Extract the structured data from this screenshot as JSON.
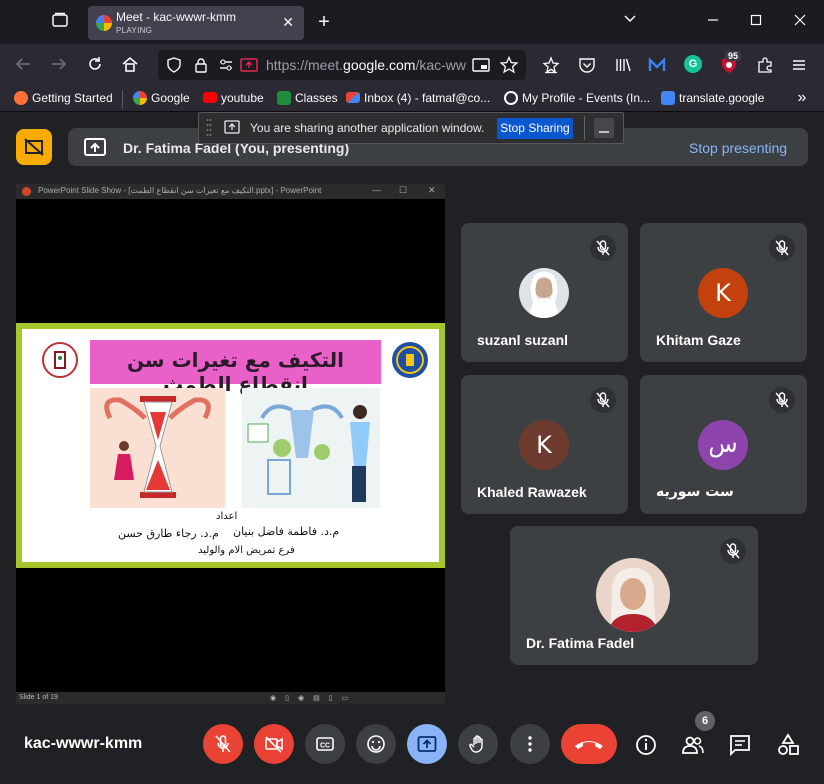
{
  "browser": {
    "tab_title": "Meet - kac-wwwr-kmm",
    "tab_status": "PLAYING",
    "url_prefix": "https://meet.",
    "url_domain": "google.com",
    "url_rest": "/kac-ww",
    "extension_badge": "95",
    "bookmarks": [
      "Getting Started",
      "Google",
      "youtube",
      "Classes",
      "Inbox (4) - fatmaf@co...",
      "My Profile - Events (In...",
      "translate.google"
    ]
  },
  "share_banner": {
    "message": "You are sharing another application window.",
    "stop_sharing_label": "Stop Sharing"
  },
  "presenter_bar": {
    "name": "Dr. Fatima Fadel (You, presenting)",
    "stop_label": "Stop presenting"
  },
  "presentation": {
    "window_title": "PowerPoint Slide Show - [التكيف مع تغيرات سن انقطاع الطمث.pptx] - PowerPoint",
    "slide_title": "التكيف مع تغيرات سن انقطاع الطمث",
    "prepared_by": "اعداد",
    "author1": "م.د. فاطمة فاضل بنيان",
    "author2": "م.د. رجاء طارق حسن",
    "department": "فرع تمريض الام والوليد",
    "slide_counter": "Slide 1 of 19"
  },
  "participants": [
    {
      "name": "suzanl suzanl",
      "avatar_letter": "",
      "avatar_color": "#dfe3e8"
    },
    {
      "name": "Khitam Gaze",
      "avatar_letter": "K",
      "avatar_color": "#c2410c"
    },
    {
      "name": "Khaled Rawazek",
      "avatar_letter": "K",
      "avatar_color": "#6d3b2e"
    },
    {
      "name": "ست سوريه",
      "avatar_letter": "س",
      "avatar_color": "#8e44ad"
    },
    {
      "name": "Dr. Fatima Fadel",
      "avatar_letter": "",
      "avatar_color": "#e9d5c9"
    }
  ],
  "meeting": {
    "code": "kac-wwwr-kmm",
    "people_count": "6"
  },
  "colors": {
    "accent": "#8ab4f8",
    "danger": "#ea4335",
    "warning": "#f9ab00",
    "slide_title_bg": "#ea60c9",
    "slide_border": "#a5c52c"
  }
}
